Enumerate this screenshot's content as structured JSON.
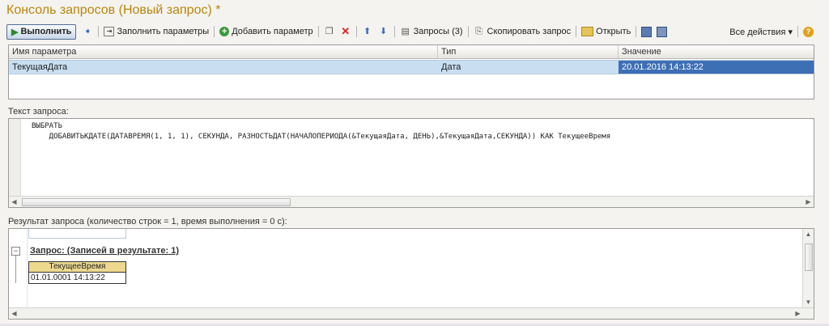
{
  "window": {
    "title": "Консоль запросов (Новый запрос) *"
  },
  "toolbar": {
    "run_label": "Выполнить",
    "fill_params_label": "Заполнить параметры",
    "add_param_label": "Добавить параметр",
    "queries_label": "Запросы (3)",
    "copy_query_label": "Скопировать запрос",
    "open_label": "Открыть",
    "all_actions_label": "Все действия ▾",
    "help_label": "?"
  },
  "params": {
    "columns": [
      "Имя параметра",
      "Тип",
      "Значение"
    ],
    "rows": [
      {
        "name": "ТекущаяДата",
        "type": "Дата",
        "value": "20.01.2016 14:13:22"
      }
    ]
  },
  "query": {
    "label": "Текст запроса:",
    "line1": "ВЫБРАТЬ",
    "line2": "    ДОБАВИТЬКДАТЕ(ДАТАВРЕМЯ(1, 1, 1), СЕКУНДА, РАЗНОСТЬДАТ(НАЧАЛОПЕРИОДА(&ТекущаяДата, ДЕНЬ),&ТекущаяДата,СЕКУНДА)) КАК ТекущееВремя"
  },
  "result": {
    "label": "Результат запроса (количество строк = 1, время выполнения = 0 с):",
    "title": "Запрос:  (Записей в результате: 1)",
    "column": "ТекущееВремя",
    "value": "01.01.0001 14:13:22"
  }
}
